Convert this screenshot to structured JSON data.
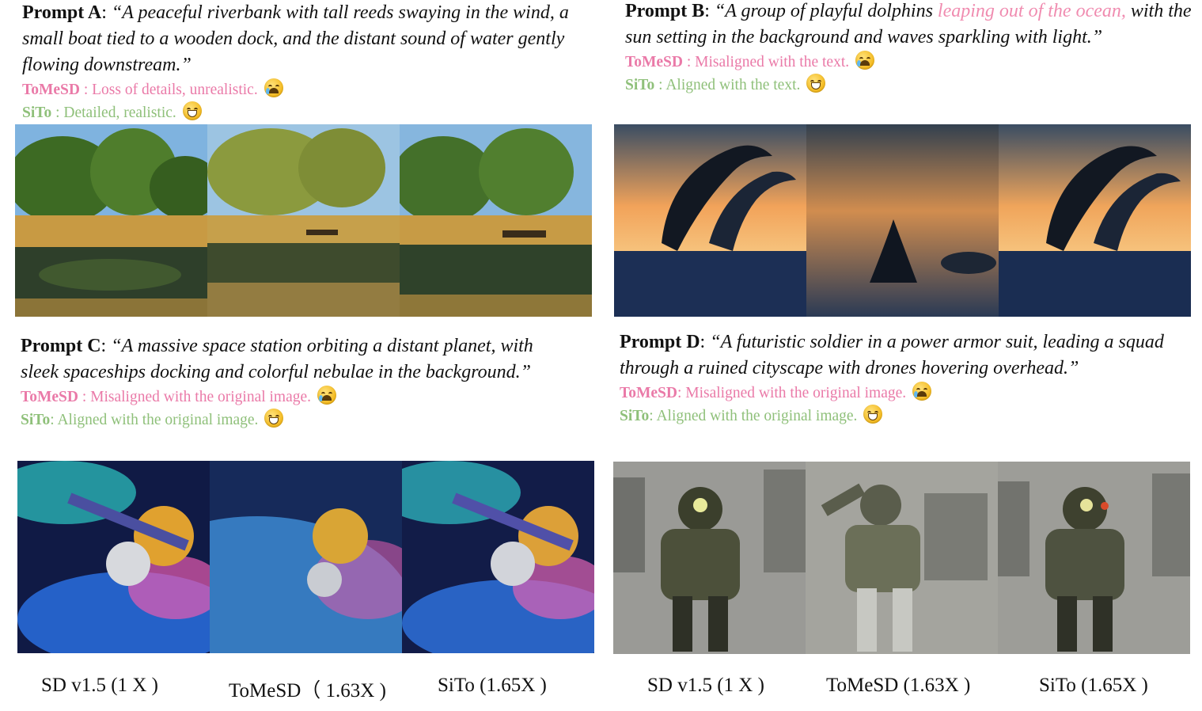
{
  "panels": [
    {
      "label": "Prompt A",
      "text_before": "“A peaceful riverbank with tall reeds swaying in the wind, a small boat tied to a wooden dock, and the distant sound of water gently flowing downstream.”",
      "text_highlight": "",
      "text_after": "",
      "tomesd_method": "ToMeSD",
      "tomesd_note": " : Loss of details, unrealistic.",
      "sito_method": "SiTo",
      "sito_note": " : Detailed, realistic.",
      "scene": "river"
    },
    {
      "label": "Prompt B",
      "text_before": "“A group of playful dolphins ",
      "text_highlight": "leaping out of the ocean,",
      "text_after": " with the sun setting in the background and waves sparkling with light.”",
      "tomesd_method": "ToMeSD",
      "tomesd_note": " : Misaligned with the text.",
      "sito_method": "SiTo",
      "sito_note": " : Aligned with the text.",
      "scene": "dolphin"
    },
    {
      "label": "Prompt C",
      "text_before": "“A massive space station orbiting a distant planet, with sleek spaceships docking and colorful nebulae in the background.”",
      "text_highlight": "",
      "text_after": "",
      "tomesd_method": "ToMeSD",
      "tomesd_note": " : Misaligned with the original image.",
      "sito_method": "SiTo",
      "sito_note": ": Aligned with the original image.",
      "scene": "space"
    },
    {
      "label": "Prompt D",
      "text_before": "“A futuristic soldier in a power armor suit, leading a squad through a ruined cityscape with drones hovering overhead.”",
      "text_highlight": "",
      "text_after": "",
      "tomesd_method": "ToMeSD",
      "tomesd_note": ": Misaligned with the original image.",
      "sito_method": "SiTo",
      "sito_note": ": Aligned with the original image.",
      "scene": "soldier"
    }
  ],
  "captions": {
    "left": [
      "SD v1.5 (1 X )",
      "ToMeSD（ 1.63X  )",
      "SiTo (1.65X  )"
    ],
    "right": [
      "SD v1.5 (1 X )",
      "ToMeSD (1.63X  )",
      "SiTo (1.65X  )"
    ]
  },
  "image_columns": [
    "SD v1.5",
    "ToMeSD",
    "SiTo"
  ],
  "colors": {
    "tomesd": "#ea7aa8",
    "sito": "#8fc07a",
    "highlight": "#f08cb0"
  }
}
